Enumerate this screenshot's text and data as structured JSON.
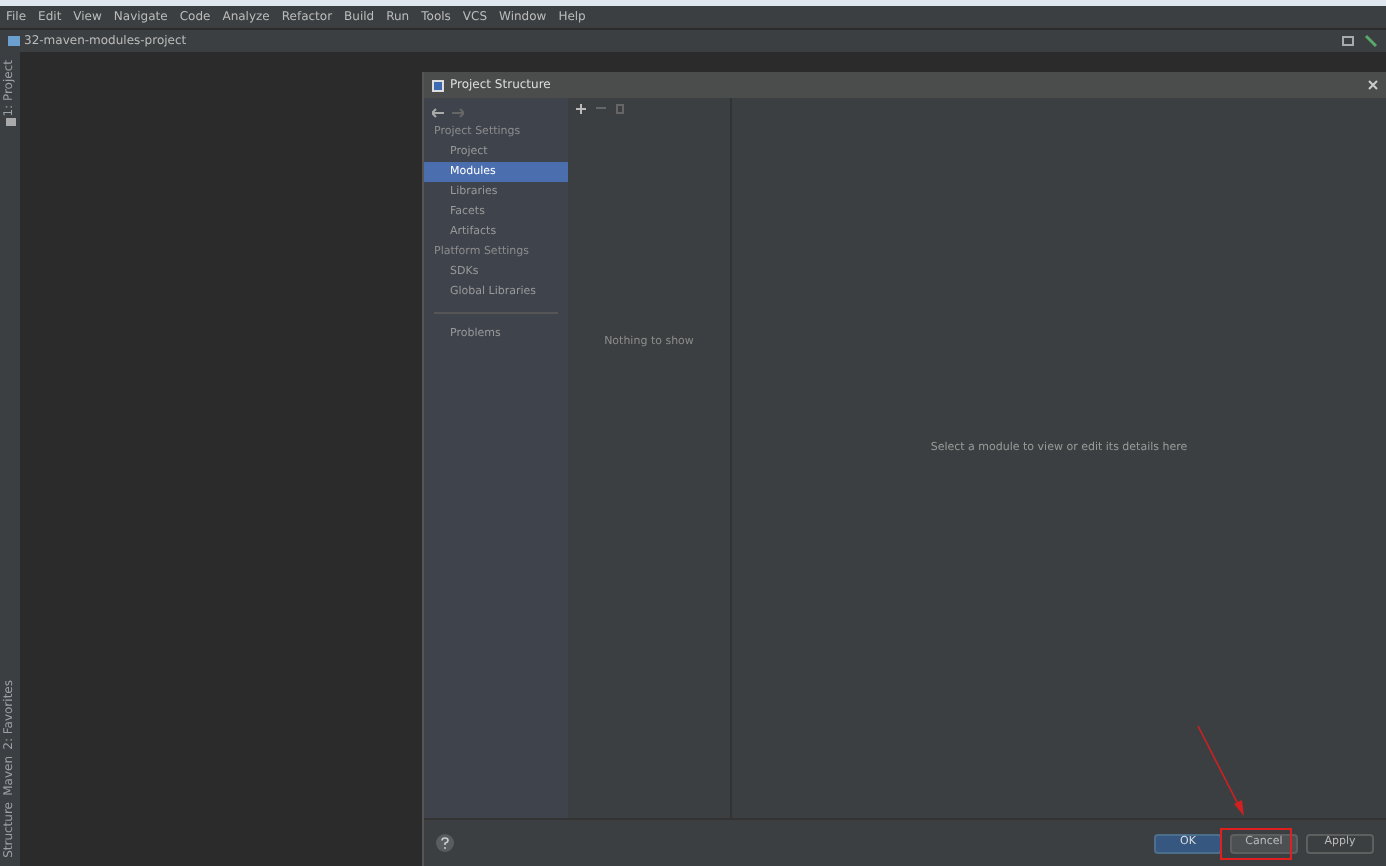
{
  "menu_bar": [
    "File",
    "Edit",
    "View",
    "Navigate",
    "Code",
    "Analyze",
    "Refactor",
    "Build",
    "Run",
    "Tools",
    "VCS",
    "Window",
    "Help"
  ],
  "project_title": "32-maven-modules-project",
  "side_tabs_top": [
    "1: Project"
  ],
  "side_tabs_bottom": [
    "2: Favorites",
    "Maven",
    "Structure"
  ],
  "dialog": {
    "title": "Project Structure",
    "sections": [
      {
        "heading": "Project Settings",
        "items": [
          {
            "label": "Project",
            "selected": false
          },
          {
            "label": "Modules",
            "selected": true
          },
          {
            "label": "Libraries",
            "selected": false
          },
          {
            "label": "Facets",
            "selected": false
          },
          {
            "label": "Artifacts",
            "selected": false
          }
        ]
      },
      {
        "heading": "Platform Settings",
        "items": [
          {
            "label": "SDKs",
            "selected": false
          },
          {
            "label": "Global Libraries",
            "selected": false
          }
        ]
      }
    ],
    "problems": "Problems",
    "empty_list": "Nothing to show",
    "details_hint": "Select a module to view or edit its details here",
    "buttons": [
      {
        "label": "OK",
        "kind": "primary",
        "disabled": false
      },
      {
        "label": "Cancel",
        "kind": "normal",
        "disabled": false
      },
      {
        "label": "Apply",
        "kind": "normal",
        "disabled": true
      }
    ]
  }
}
